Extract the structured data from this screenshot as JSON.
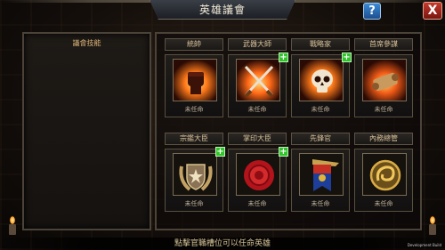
{
  "window": {
    "title": "英雄議會"
  },
  "buttons": {
    "help_label": "?",
    "close_label": "X"
  },
  "skill_panel": {
    "title": "議會技能"
  },
  "slots": [
    {
      "title": "統帥",
      "status": "未任命",
      "icon": "flaming-fist-icon",
      "has_plus": false
    },
    {
      "title": "武器大師",
      "status": "未任命",
      "icon": "crossed-swords-icon",
      "has_plus": true
    },
    {
      "title": "戰略家",
      "status": "未任命",
      "icon": "flaming-skull-icon",
      "has_plus": true
    },
    {
      "title": "首席參謀",
      "status": "未任命",
      "icon": "flaming-scroll-icon",
      "has_plus": false
    },
    {
      "title": "宗鑑大臣",
      "status": "未任命",
      "icon": "laurel-shield-icon",
      "has_plus": true
    },
    {
      "title": "掌印大臣",
      "status": "未任命",
      "icon": "wax-seal-icon",
      "has_plus": true
    },
    {
      "title": "先鋒官",
      "status": "未任命",
      "icon": "banner-trumpet-icon",
      "has_plus": false
    },
    {
      "title": "內務總管",
      "status": "未任命",
      "icon": "dragon-coin-icon",
      "has_plus": false
    }
  ],
  "footer": {
    "hint": "點擊官職槽位可以任命英雄",
    "build": "Development Build"
  },
  "colors": {
    "accent_gold": "#d9c19a",
    "plus_green": "#2fc42a",
    "close_red": "#c6392c",
    "help_blue": "#3b8ad6"
  }
}
